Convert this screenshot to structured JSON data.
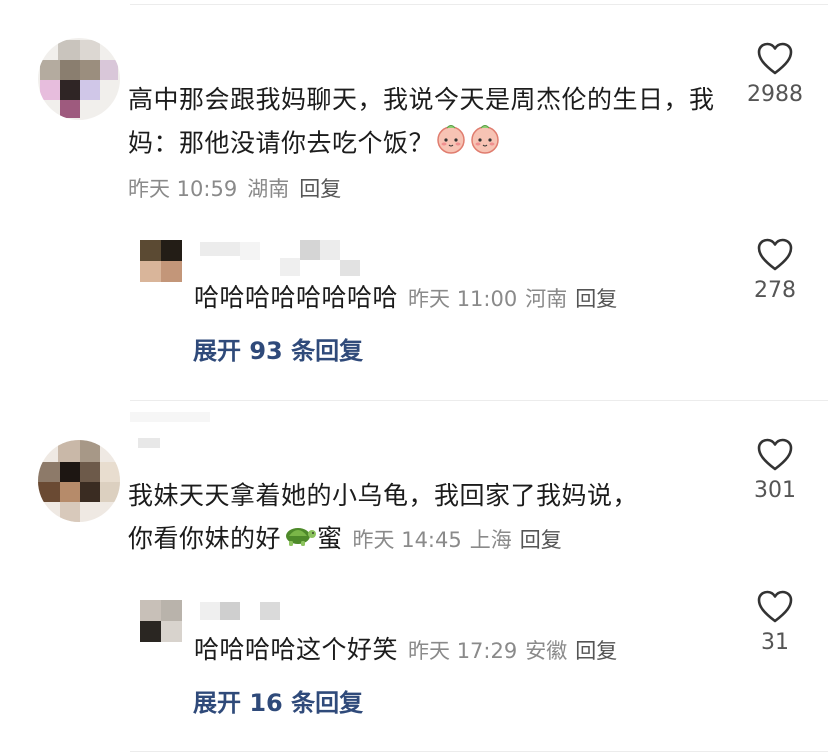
{
  "comments": [
    {
      "text": "高中那会跟我妈聊天，我说今天是周杰伦的生日，我妈：那他没请你去吃个饭？",
      "emojis": [
        "peach-blush-emoji",
        "peach-blush-emoji"
      ],
      "time": "昨天 10:59",
      "location": "湖南",
      "reply_label": "回复",
      "likes": "2988",
      "reply": {
        "text": "哈哈哈哈哈哈哈哈",
        "time": "昨天 11:00",
        "location": "河南",
        "reply_label": "回复",
        "likes": "278"
      },
      "expand_label": "展开 93 条回复"
    },
    {
      "text_line1": "我妹天天拿着她的小乌龟，我回家了我妈说，",
      "text_line2_pre": "你看你妹的好",
      "emoji": "turtle-emoji",
      "text_line2_post": "蜜",
      "time": "昨天 14:45",
      "location": "上海",
      "reply_label": "回复",
      "likes": "301",
      "reply": {
        "text": "哈哈哈哈这个好笑",
        "time": "昨天 17:29",
        "location": "安徽",
        "reply_label": "回复",
        "likes": "31"
      },
      "expand_label": "展开 16 条回复"
    }
  ],
  "colors": {
    "link": "#2f4a7a",
    "meta": "#8a8a8a",
    "text": "#1c1c1c"
  }
}
